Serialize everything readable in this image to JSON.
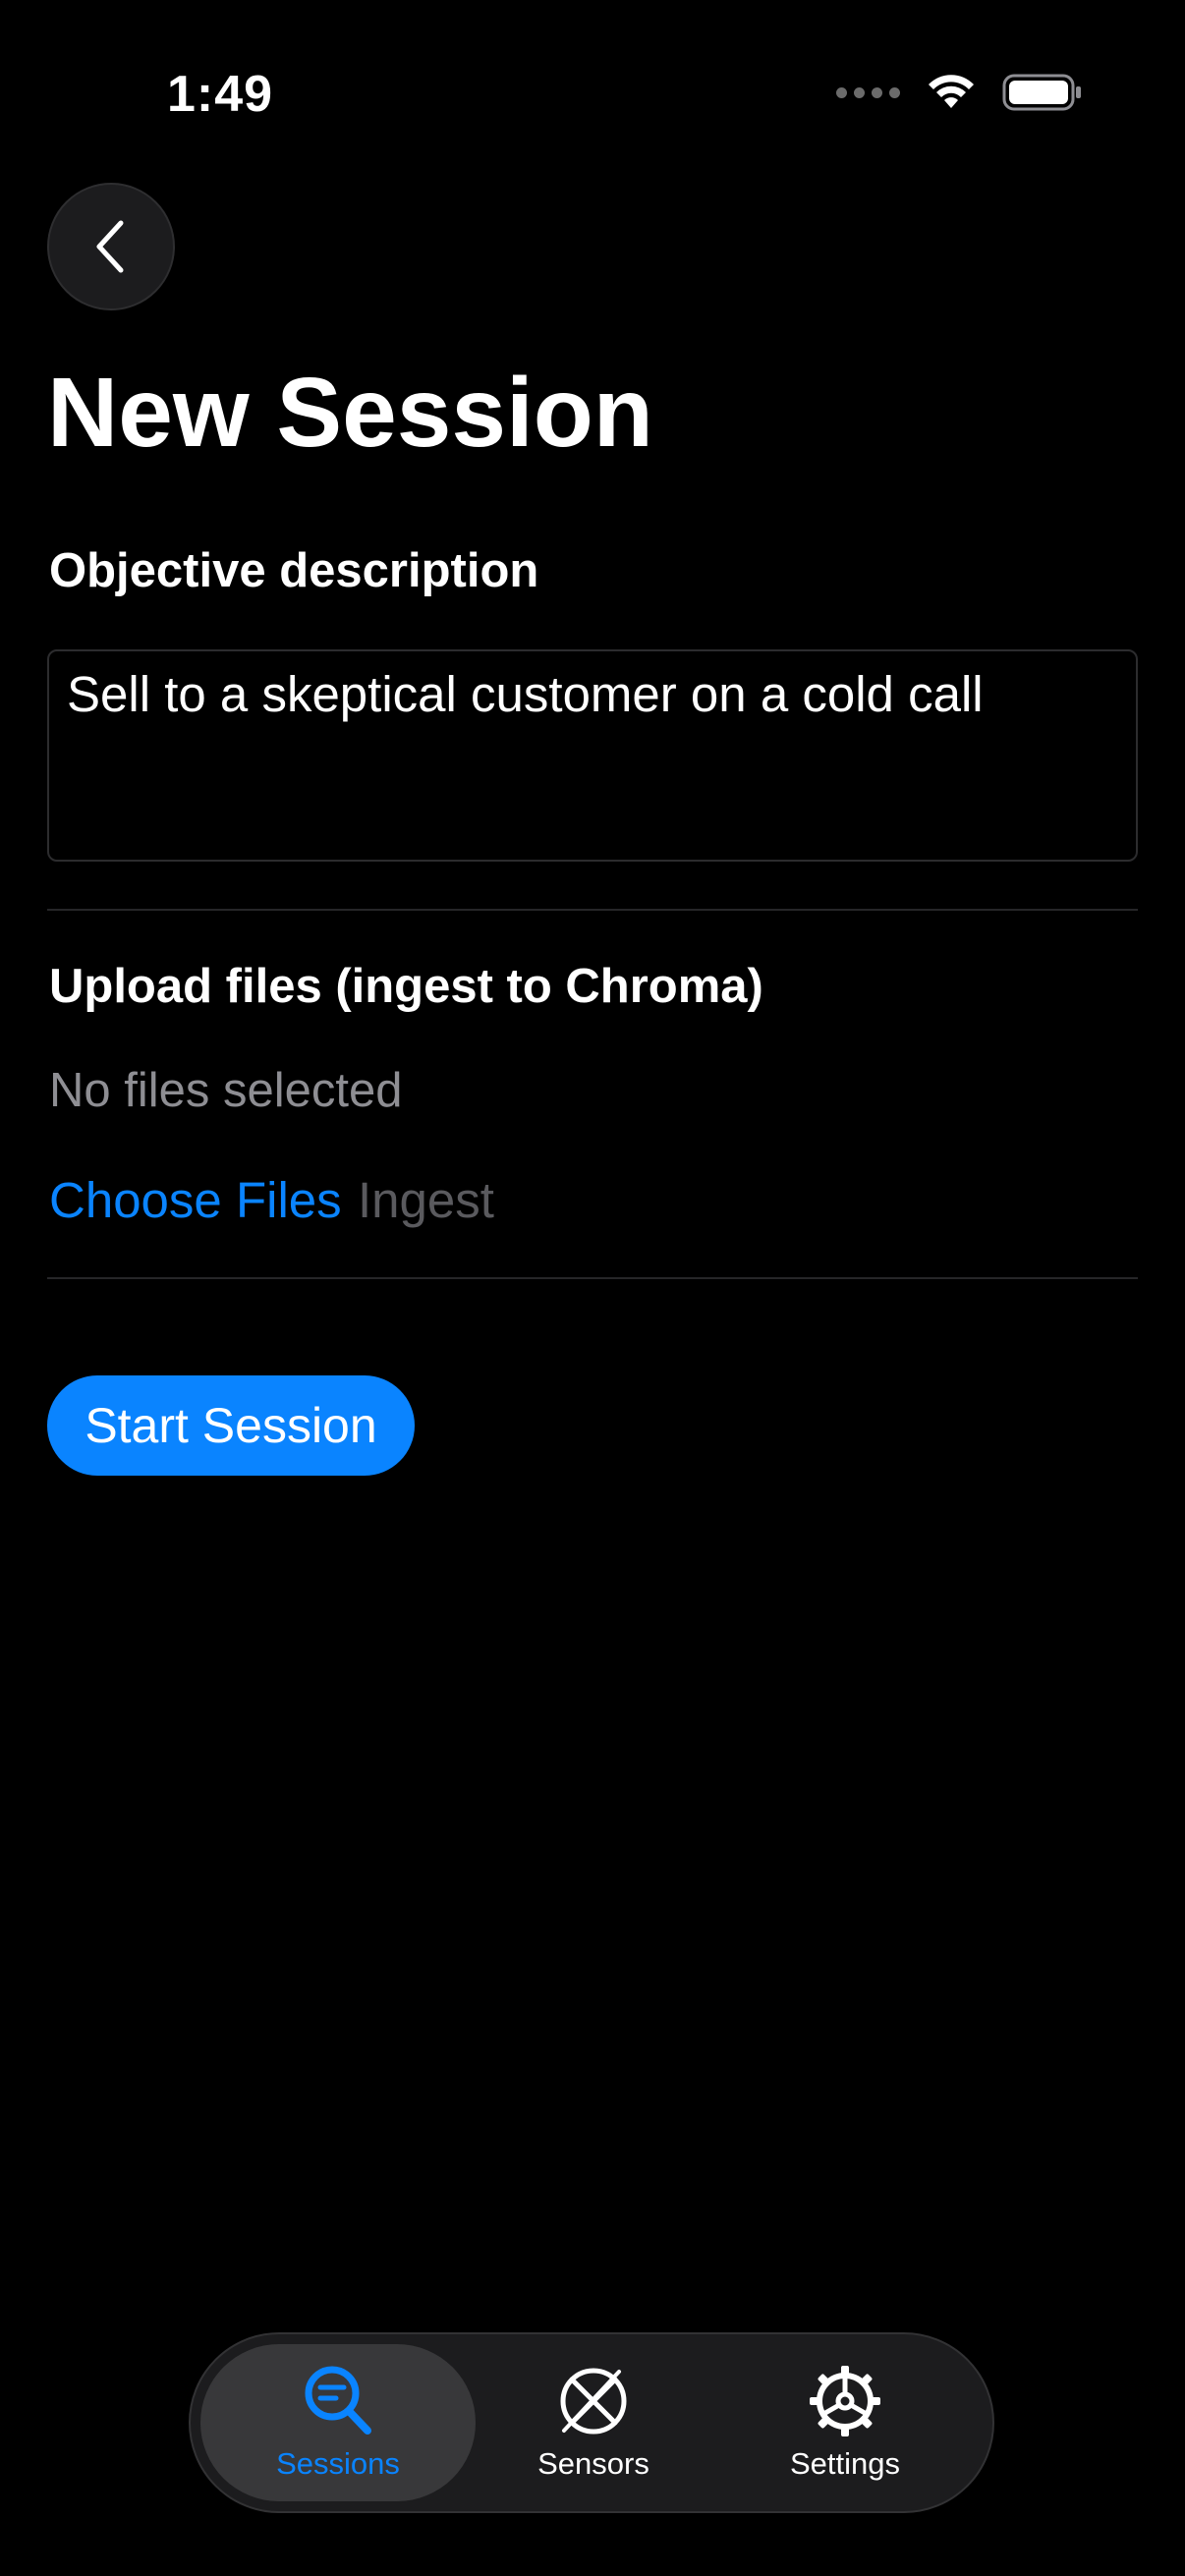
{
  "status_bar": {
    "time": "1:49"
  },
  "header": {
    "title": "New Session"
  },
  "objective": {
    "label": "Objective description",
    "value": "Sell to a skeptical customer on a cold call"
  },
  "upload": {
    "label": "Upload files (ingest to Chroma)",
    "status": "No files selected",
    "choose_label": "Choose Files",
    "ingest_label": "Ingest"
  },
  "actions": {
    "start_label": "Start Session"
  },
  "tab_bar": {
    "tabs": [
      {
        "label": "Sessions",
        "icon": "search-list-icon",
        "active": true
      },
      {
        "label": "Sensors",
        "icon": "sensors-icon",
        "active": false
      },
      {
        "label": "Settings",
        "icon": "gear-icon",
        "active": false
      }
    ]
  },
  "colors": {
    "accent": "#0a84ff",
    "background": "#000000",
    "secondary_text": "#8e8e93",
    "disabled_text": "#5a5a5e"
  }
}
